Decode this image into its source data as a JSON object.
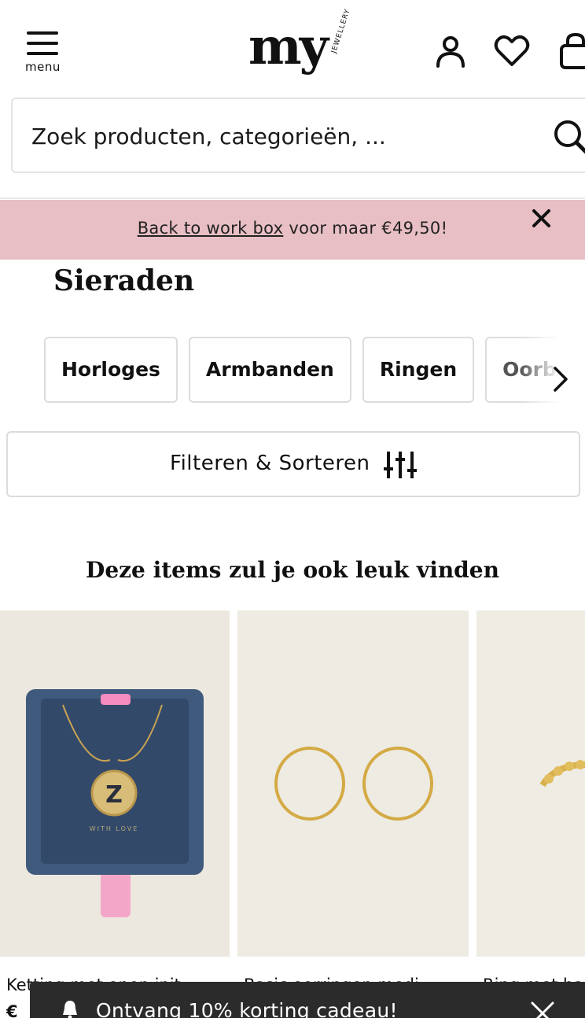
{
  "header": {
    "menu_label": "menu",
    "logo_text": "my",
    "logo_subtext": "JEWELLERY",
    "icons": [
      "account-icon",
      "heart-icon",
      "shopping-bag-icon"
    ]
  },
  "search": {
    "placeholder": "Zoek producten, categorieën, ..."
  },
  "promo": {
    "link_text": "Back to work box",
    "text": " voor maar €49,50!",
    "background": "#e8bfc4"
  },
  "category": {
    "title": "Sieraden",
    "chips": [
      "Horloges",
      "Armbanden",
      "Ringen",
      "Oorbellen"
    ]
  },
  "filter": {
    "label": "Filteren & Sorteren"
  },
  "recommendations": {
    "title": "Deze items zul je ook leuk vinden",
    "products": [
      {
        "name": "Ketting met open init...",
        "price": "€"
      },
      {
        "name": "Basic oorringen medi...",
        "price": ""
      },
      {
        "name": "Ring met hartjes",
        "price": ""
      }
    ]
  },
  "toast": {
    "text": "Ontvang 10% korting cadeau!"
  }
}
